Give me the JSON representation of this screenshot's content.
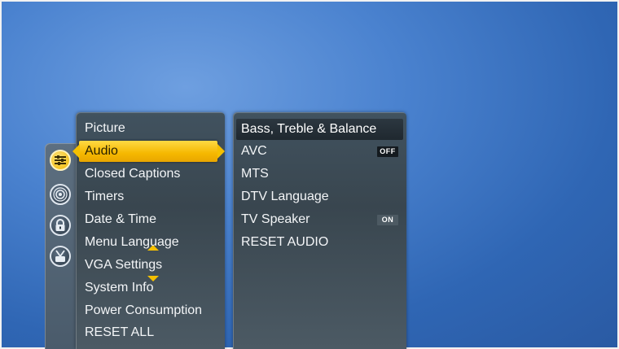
{
  "rail": {
    "icons": [
      "settings-sliders-icon",
      "broadcast-antenna-icon",
      "padlock-icon",
      "tv-antenna-icon"
    ]
  },
  "main_menu": {
    "items": [
      {
        "label": "Picture"
      },
      {
        "label": "Audio",
        "selected": true
      },
      {
        "label": "Closed Captions"
      },
      {
        "label": "Timers"
      },
      {
        "label": "Date & Time"
      },
      {
        "label": "Menu Language"
      },
      {
        "label": "VGA Settings"
      },
      {
        "label": "System Info"
      },
      {
        "label": "Power Consumption"
      },
      {
        "label": "RESET ALL"
      }
    ]
  },
  "sub_menu": {
    "header": "Bass, Treble & Balance",
    "items": [
      {
        "label": "AVC",
        "badge": "OFF"
      },
      {
        "label": "MTS"
      },
      {
        "label": "DTV Language"
      },
      {
        "label": "TV Speaker",
        "badge": "ON"
      },
      {
        "label": "RESET AUDIO"
      }
    ]
  },
  "colors": {
    "background": "#3a74c4",
    "selection": "#f5b800",
    "panel": "#3d4b55"
  }
}
